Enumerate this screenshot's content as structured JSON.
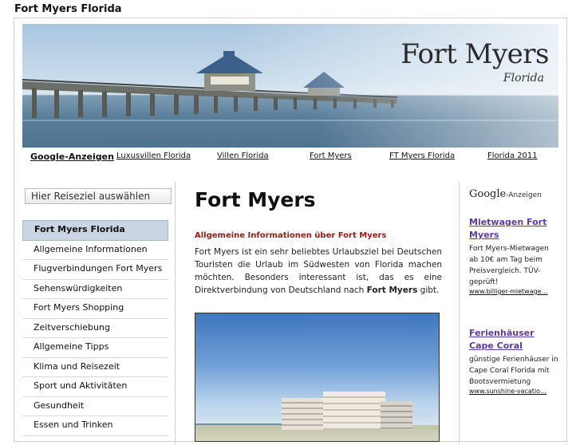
{
  "page": {
    "title": "Fort Myers Florida"
  },
  "banner": {
    "title": "Fort Myers",
    "subtitle": "Florida"
  },
  "topnav": {
    "items": [
      {
        "label": "Google-Anzeigen"
      },
      {
        "label": "Luxusvillen Florida"
      },
      {
        "label": "Villen Florida"
      },
      {
        "label": "Fort Myers"
      },
      {
        "label": "FT Myers Florida"
      },
      {
        "label": "Florida 2011"
      }
    ]
  },
  "sidebar": {
    "destination_label": "Hier Reiseziel auswählen",
    "items": [
      {
        "label": "Fort Myers Florida"
      },
      {
        "label": "Allgemeine Informationen"
      },
      {
        "label": "Flugverbindungen Fort Myers"
      },
      {
        "label": "Sehenswürdigkeiten"
      },
      {
        "label": "Fort Myers Shopping"
      },
      {
        "label": "Zeitverschiebung"
      },
      {
        "label": "Allgemeine Tipps"
      },
      {
        "label": "Klima und Reisezeit"
      },
      {
        "label": "Sport und Aktivitäten"
      },
      {
        "label": "Gesundheit"
      },
      {
        "label": "Essen und Trinken"
      }
    ]
  },
  "main": {
    "heading": "Fort Myers",
    "subheading": "Allgemeine Informationen über Fort Myers",
    "paragraph_start": "Fort Myers ist ein sehr beliebtes Urlaubsziel bei Deutschen Touristen die Urlaub im Südwesten von Florida machen möchten. Besonders interessant ist, das es eine Direktverbindung von Deutschland nach ",
    "paragraph_bold": "Fort Myers",
    "paragraph_end": " gibt."
  },
  "ads": {
    "google_logo": "Google",
    "header_suffix": "-Anzeigen",
    "items": [
      {
        "title": "Mietwagen Fort Myers",
        "description": "Fort Myers-Mietwagen ab 10€ am Tag beim Preisvergleich. TÜV-geprüft!",
        "url": "www.billiger-mietwage…"
      },
      {
        "title": "Ferienhäuser Cape Coral",
        "description": "günstige Ferienhäuser in Cape Coral Florida mit Bootsvermietung",
        "url": "www.sunshine-vacatio…"
      }
    ]
  },
  "colors": {
    "accent_red": "#a01818",
    "ad_link": "#5d3aa3",
    "active_menu": "#c9d5e2"
  }
}
